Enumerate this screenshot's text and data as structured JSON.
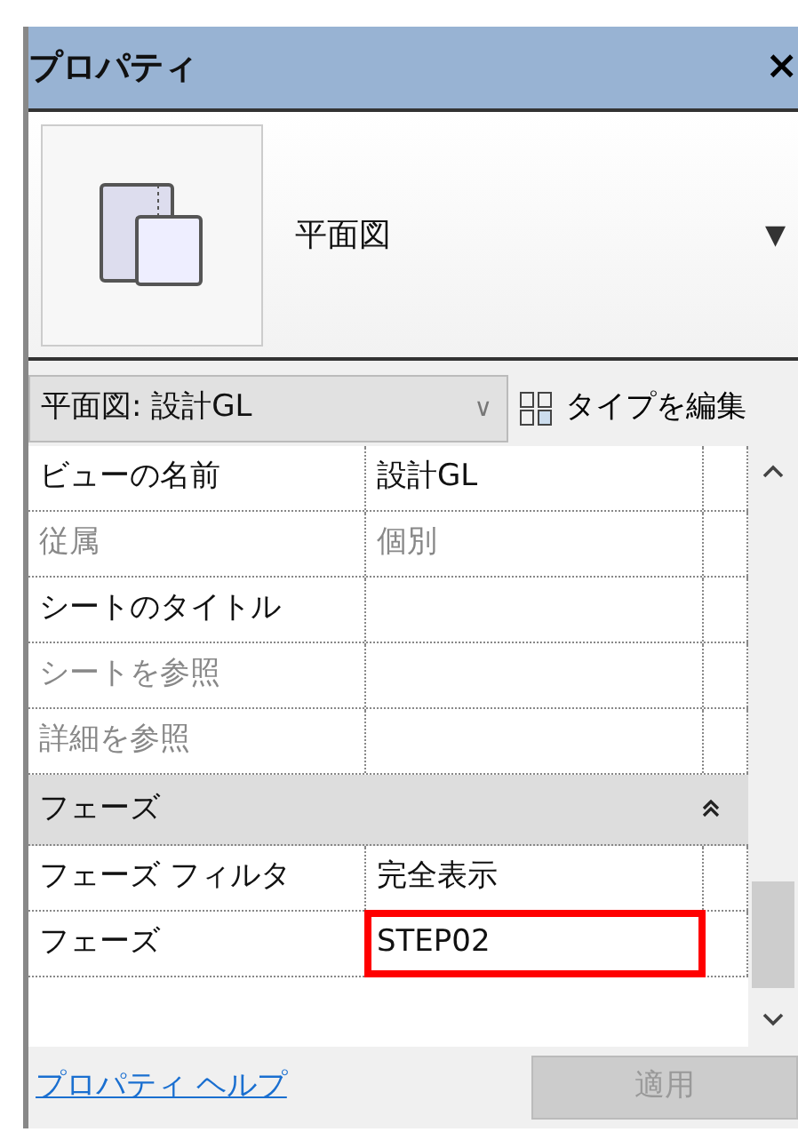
{
  "panel": {
    "title": "プロパティ",
    "close": "×"
  },
  "type_selector": {
    "name": "平面図",
    "caret": "▼"
  },
  "view_dropdown": {
    "value": "平面図: 設計GL",
    "caret": "∨"
  },
  "edit_type_button": {
    "label": "タイプを編集"
  },
  "sections": [
    {
      "rows": [
        {
          "label": "ビューの名前",
          "value": "設計GL",
          "disabled": false,
          "highlighted": false
        },
        {
          "label": "従属",
          "value": "個別",
          "disabled": true,
          "highlighted": false
        },
        {
          "label": "シートのタイトル",
          "value": null,
          "disabled": false,
          "highlighted": false
        },
        {
          "label": "シートを参照",
          "value": null,
          "disabled": true,
          "highlighted": false
        },
        {
          "label": "詳細を参照",
          "value": null,
          "disabled": true,
          "highlighted": false
        }
      ]
    },
    {
      "header": {
        "title": "フェーズ",
        "expanded": true
      },
      "rows": [
        {
          "label": "フェーズ フィルタ",
          "value": "完全表示",
          "disabled": false,
          "highlighted": false
        },
        {
          "label": "フェーズ",
          "value": "STEP02",
          "disabled": false,
          "highlighted": true
        }
      ]
    }
  ],
  "footer": {
    "help_link": "プロパティ ヘルプ",
    "apply_button": {
      "label": "適用",
      "disabled": true
    }
  }
}
